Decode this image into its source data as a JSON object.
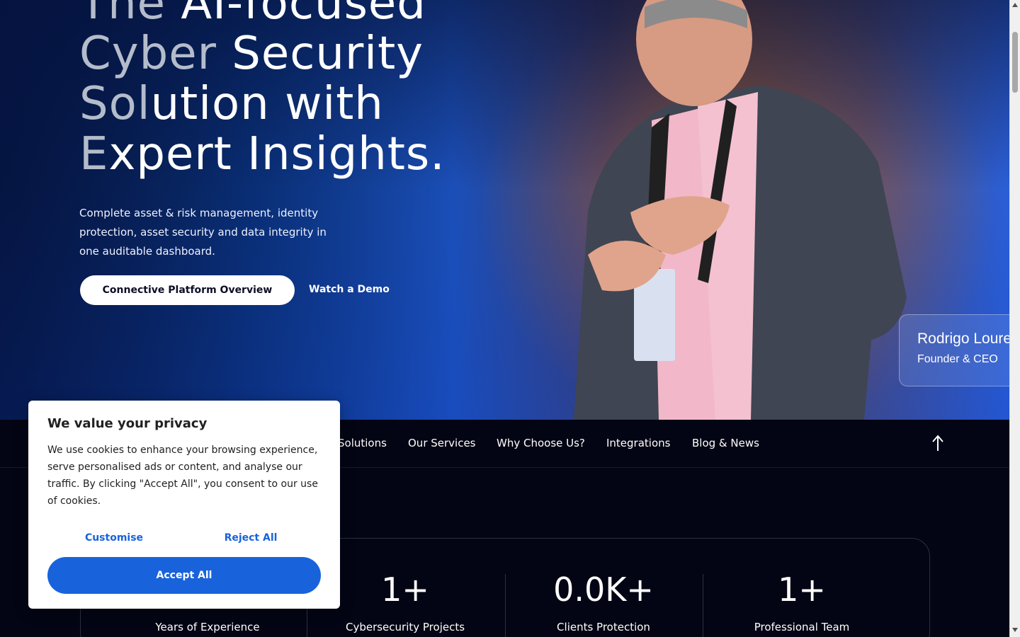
{
  "hero": {
    "title_lines": [
      {
        "dim": "The ",
        "bright": "AI-focused"
      },
      {
        "dim": "Cyber ",
        "bright": "Security"
      },
      {
        "dim": "Sol",
        "bright": "ution with"
      },
      {
        "dim": "E",
        "bright": "xpert Insights."
      }
    ],
    "description": "Complete asset & risk management, identity protection, asset security and data integrity in one auditable dashboard.",
    "primary_button": "Connective Platform Overview",
    "demo_link": "Watch a Demo",
    "profile": {
      "name": "Rodrigo Loureiro",
      "role": "Founder & CEO"
    }
  },
  "nav": {
    "items": [
      "Solutions",
      "Our Services",
      "Why Choose Us?",
      "Integrations",
      "Blog & News"
    ],
    "scroll_top_icon": "arrow-up-icon"
  },
  "stats": [
    {
      "value": "",
      "label": "Years of Experience"
    },
    {
      "value": "1+",
      "label": "Cybersecurity Projects"
    },
    {
      "value": "0.0K+",
      "label": "Clients Protection"
    },
    {
      "value": "1+",
      "label": "Professional Team"
    }
  ],
  "cookie": {
    "title": "We value your privacy",
    "text": "We use cookies to enhance your browsing experience, serve personalised ads or content, and analyse our traffic. By clicking \"Accept All\", you consent to our use of cookies.",
    "customise": "Customise",
    "reject": "Reject All",
    "accept": "Accept All"
  },
  "colors": {
    "accent": "#1863dc",
    "background": "#040514",
    "hero_blue": "#1b4fb8"
  }
}
